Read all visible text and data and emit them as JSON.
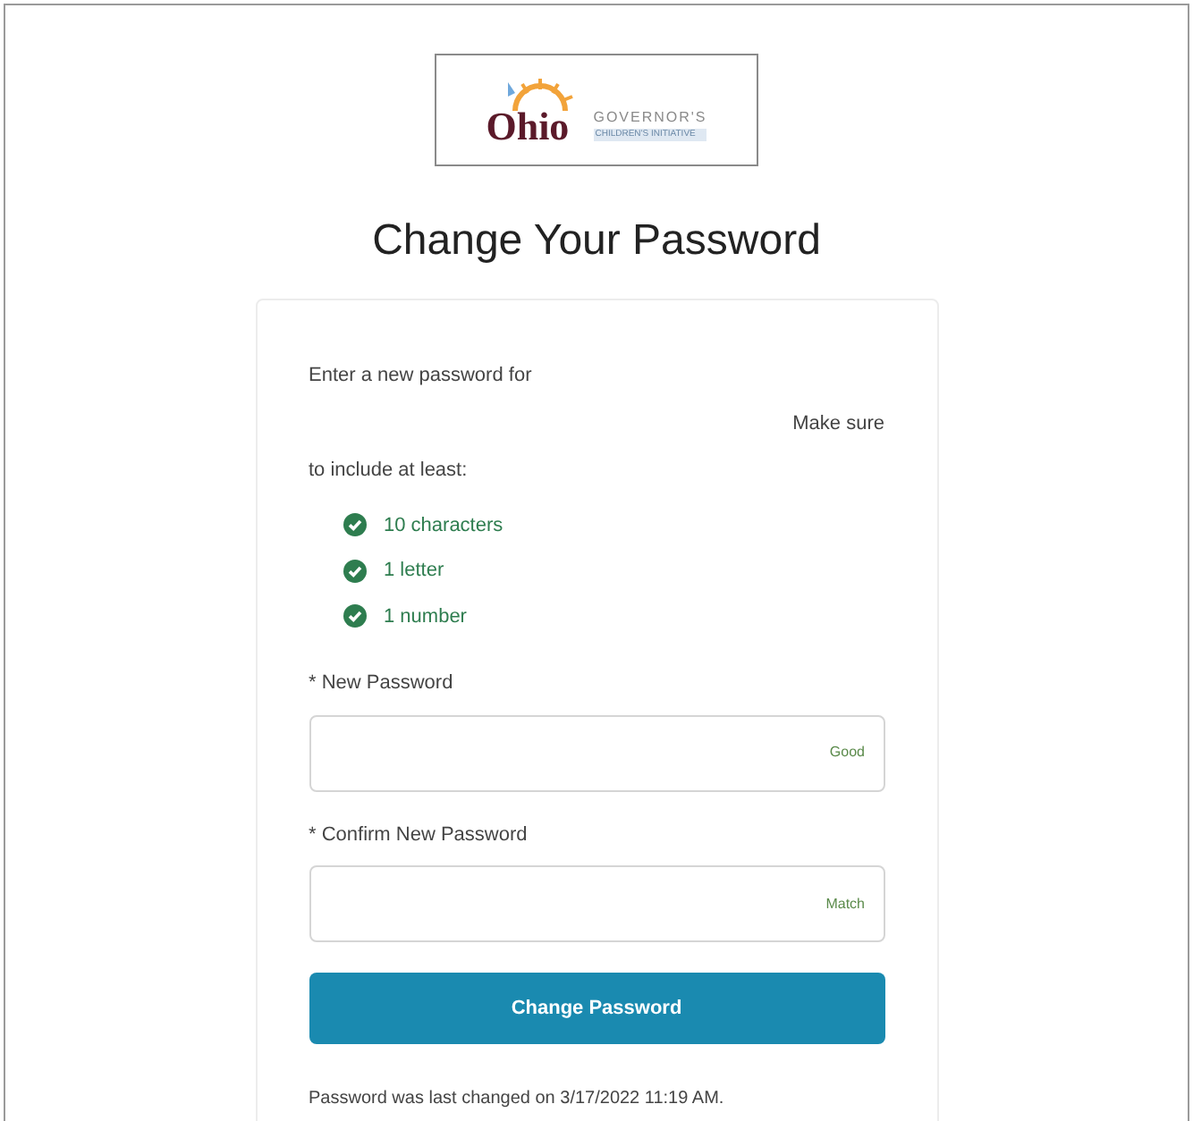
{
  "logo": {
    "name": "Ohio",
    "line_1": "GOVERNOR'S",
    "line_2": "CHILDREN'S INITIATIVE"
  },
  "title": "Change Your Password",
  "intro": {
    "line_1": "Enter a new password for",
    "line_2": "Make sure",
    "line_3": "to include at least:"
  },
  "requirements": [
    {
      "label": "10 characters",
      "checked": true
    },
    {
      "label": "1 letter",
      "checked": true
    },
    {
      "label": "1 number",
      "checked": true
    }
  ],
  "fields": [
    {
      "label": "* New Password",
      "status": "Good"
    },
    {
      "label": "* Confirm New Password",
      "status": "Match"
    }
  ],
  "submit_button": "Change Password",
  "footer": "Password was last changed on 3/17/2022 11:19 AM."
}
